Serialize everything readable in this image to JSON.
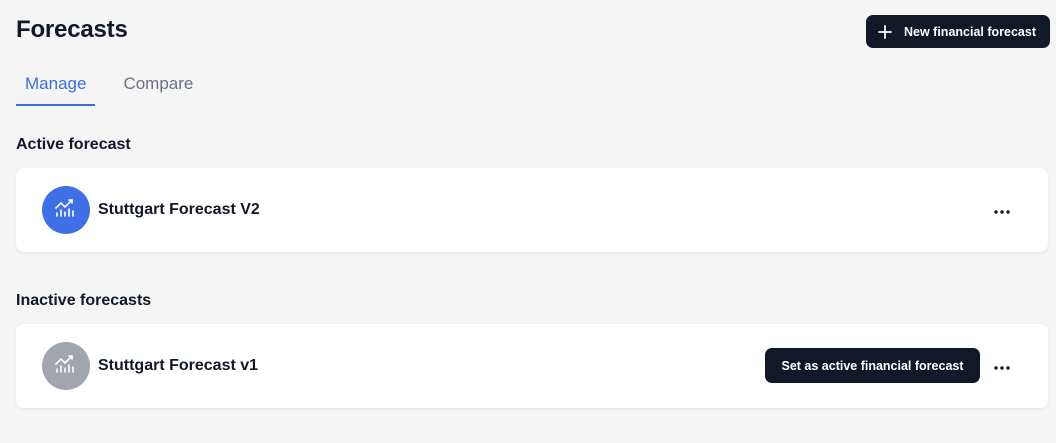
{
  "header": {
    "title": "Forecasts",
    "new_button_label": "New financial forecast",
    "new_button_icon": "plus-icon"
  },
  "tabs": [
    {
      "label": "Manage",
      "active": true
    },
    {
      "label": "Compare",
      "active": false
    }
  ],
  "active_section": {
    "title": "Active forecast",
    "forecasts": [
      {
        "name": "Stuttgart Forecast V2",
        "icon": "chart-trend-icon",
        "icon_bg": "#3f6fe6"
      }
    ]
  },
  "inactive_section": {
    "title": "Inactive forecasts",
    "forecasts": [
      {
        "name": "Stuttgart Forecast v1",
        "icon": "chart-trend-icon",
        "icon_bg": "#a1a5ad",
        "action_label": "Set as active financial forecast"
      }
    ]
  },
  "colors": {
    "accent": "#3b6fd8",
    "dark": "#111827",
    "background": "#f5f5f5"
  }
}
